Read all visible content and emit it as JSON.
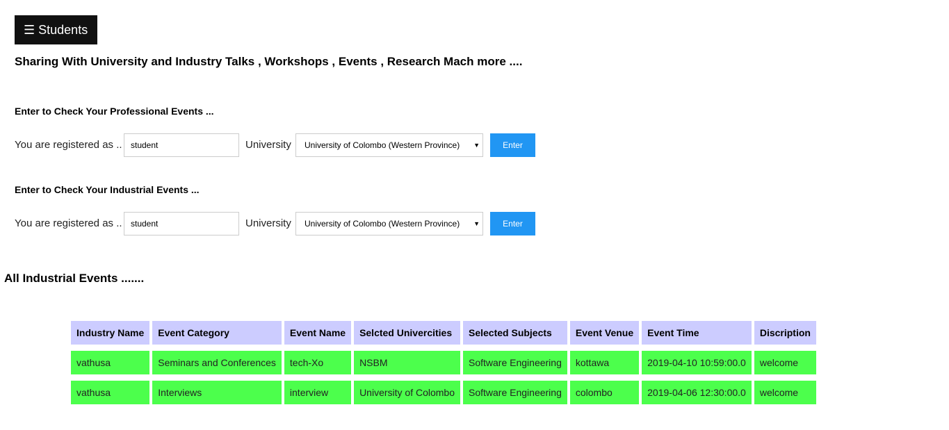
{
  "header": {
    "menu_icon": "☰",
    "menu_label": "Students",
    "tagline": "Sharing With University and Industry Talks , Workshops , Events , Research Mach more ...."
  },
  "professional": {
    "heading": "Enter to Check Your Professional Events ...",
    "registered_label": "You are registered as ..",
    "role_value": "student",
    "university_label": "University",
    "university_selected": "University of Colombo (Western Province)",
    "enter_label": "Enter"
  },
  "industrial": {
    "heading": "Enter to Check Your Industrial Events ...",
    "registered_label": "You are registered as ..",
    "role_value": "student",
    "university_label": "University",
    "university_selected": "University of Colombo (Western Province)",
    "enter_label": "Enter"
  },
  "events": {
    "heading": "All Industrial Events .......",
    "columns": [
      "Industry Name",
      "Event Category",
      "Event Name",
      "Selcted Univercities",
      "Selected Subjects",
      "Event Venue",
      "Event Time",
      "Discription"
    ],
    "rows": [
      [
        "vathusa",
        "Seminars and Conferences",
        "tech-Xo",
        "NSBM",
        "Software Engineering",
        "kottawa",
        "2019-04-10 10:59:00.0",
        "welcome"
      ],
      [
        "vathusa",
        "Interviews",
        "interview",
        "University of Colombo",
        "Software Engineering",
        "colombo",
        "2019-04-06 12:30:00.0",
        "welcome"
      ]
    ]
  },
  "colors": {
    "menu_bg": "#111111",
    "button_bg": "#2196f3",
    "header_cell_bg": "#ccccff",
    "data_cell_bg": "#4cff4c"
  }
}
